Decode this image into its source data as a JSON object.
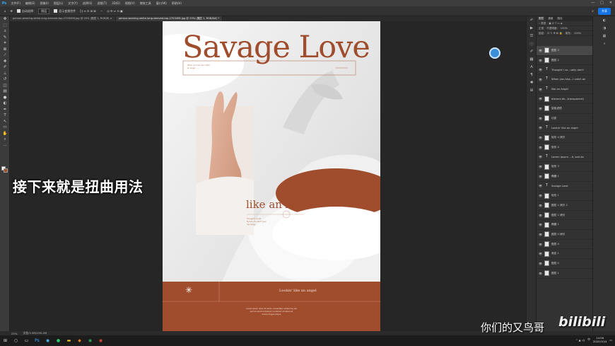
{
  "app": {
    "menu": [
      "文件(F)",
      "编辑(E)",
      "图像(I)",
      "图层(L)",
      "文字(Y)",
      "选择(S)",
      "滤镜(T)",
      "3D(D)",
      "视图(V)",
      "增效工具",
      "窗口(W)",
      "帮助(H)"
    ],
    "window_controls": [
      "—",
      "□",
      "✕"
    ]
  },
  "options_bar": {
    "auto_select_label": "自动选择:",
    "auto_select_value": "图层",
    "transform_label": "显示变换控件",
    "share_label": "共享"
  },
  "tabs": [
    {
      "label": "person-wearing-white-long-sleeved-top-2703498.jpg @ 25% (图层 1, RGB/8) ×",
      "active": false
    },
    {
      "label": "person-wearing-white-long-sleeved-top-2703498.jpg @ 25% (图层 1, RGB/8#) *",
      "active": true
    }
  ],
  "poster": {
    "title": "Savage Love",
    "tagline": "like an Angel",
    "footer_center": "Lookin' like an angel",
    "footer_star": "✳",
    "colors": {
      "rust": "#a04d2d",
      "cream": "#f4efe9",
      "line": "#c9a08f"
    }
  },
  "layers_panel": {
    "tabs": [
      "图层",
      "通道",
      "路径"
    ],
    "blend_mode": "正常",
    "opacity_label": "不透明度:",
    "opacity_value": "100%",
    "lock_label": "锁定:",
    "fill_label": "填充:",
    "fill_value": "100%",
    "layers": [
      {
        "name": "图层 3",
        "type": "image",
        "selected": true
      },
      {
        "name": "图层 2",
        "type": "image",
        "selected": false
      },
      {
        "name": "Thought I co...ually don't",
        "type": "text",
        "selected": false
      },
      {
        "name": "When you kiss...I catch an",
        "type": "text",
        "selected": false
      },
      {
        "name": "like an Angel",
        "type": "text",
        "selected": false
      },
      {
        "name": "distend dk...transparent)",
        "type": "image",
        "selected": false
      },
      {
        "name": "智能滤镜",
        "type": "image",
        "selected": false
      },
      {
        "name": "切变",
        "type": "image",
        "selected": false
      },
      {
        "name": "Lookin' like an angel",
        "type": "text",
        "selected": false
      },
      {
        "name": "矩形 4 拷贝",
        "type": "image",
        "selected": false
      },
      {
        "name": "矩形 4",
        "type": "image",
        "selected": false
      },
      {
        "name": "Lorem ipsum ...it, sed do",
        "type": "text",
        "selected": false
      },
      {
        "name": "矩形 3",
        "type": "image",
        "selected": false
      },
      {
        "name": "椭圆 1",
        "type": "image",
        "selected": false
      },
      {
        "name": "Savage Love",
        "type": "text",
        "selected": false
      },
      {
        "name": "矩形 1",
        "type": "image",
        "selected": false
      },
      {
        "name": "图层 1 拷贝 2",
        "type": "image",
        "selected": false
      },
      {
        "name": "图层 1 拷贝",
        "type": "image",
        "selected": false
      },
      {
        "name": "椭圆 1",
        "type": "image",
        "selected": false
      },
      {
        "name": "图层 0 拷贝",
        "type": "image",
        "selected": false
      },
      {
        "name": "图层 0",
        "type": "image",
        "selected": false
      },
      {
        "name": "渐变 1",
        "type": "image",
        "selected": false
      },
      {
        "name": "图层 0",
        "type": "image",
        "selected": false
      },
      {
        "name": "图层 1",
        "type": "image",
        "selected": false
      }
    ]
  },
  "status": {
    "zoom": "25%",
    "doc": "文档:5.5M/195.4M"
  },
  "taskbar": {
    "time": "14:56",
    "date": "2020/10/4",
    "lang": "中"
  },
  "overlay": {
    "subtitle": "接下来就是扭曲用法",
    "watermark": "你们的又鸟哥",
    "brand": "bilibili"
  }
}
